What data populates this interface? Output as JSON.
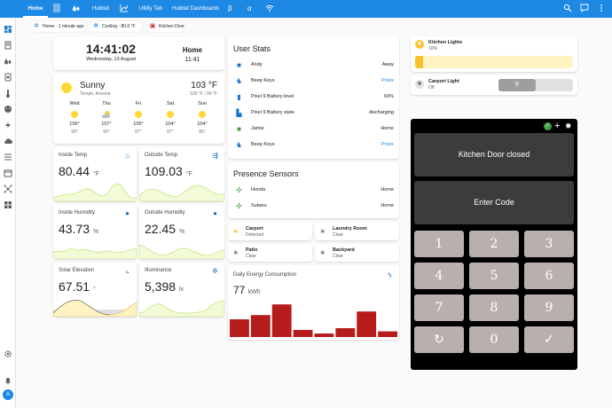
{
  "topbar": {
    "tabs": [
      {
        "label": "Home",
        "active": true
      },
      {
        "label": "Hubitat"
      },
      {
        "label": "Utility Tab"
      },
      {
        "label": "Hubitat Dashboards"
      }
    ],
    "glyph_tabs": [
      "β",
      "α"
    ],
    "colors": {
      "bar": "#1e88e5"
    }
  },
  "chips": [
    {
      "text": "Home · 1 minute ago",
      "icon": "home-sync-icon"
    },
    {
      "text": "Cooling · 80.6 °F",
      "icon": "thermostat-icon"
    },
    {
      "text": "Kitchen Door",
      "icon": "door-icon"
    }
  ],
  "clock": {
    "time": "14:41:02",
    "date": "Wednesday, 13 August",
    "zone_label": "Home",
    "zone_time": "11:41"
  },
  "weather": {
    "condition": "Sunny",
    "location": "Tempe, Arizona",
    "temp": "103 °F",
    "range": "109 °F / 99 °F",
    "forecast": [
      {
        "day": "Wed",
        "icon": "sun",
        "high": "109°",
        "low": "99°"
      },
      {
        "day": "Thu",
        "icon": "partly-cloudy",
        "high": "107°",
        "low": "90°"
      },
      {
        "day": "Fri",
        "icon": "sun",
        "high": "105°",
        "low": "87°"
      },
      {
        "day": "Sat",
        "icon": "sun",
        "high": "104°",
        "low": "87°"
      },
      {
        "day": "Sun",
        "icon": "sun",
        "high": "104°",
        "low": "85°"
      }
    ]
  },
  "sensors": [
    {
      "title": "Inside Temp",
      "value": "80.44",
      "unit": "°F",
      "icon": "thermostat-icon"
    },
    {
      "title": "Outside Temp",
      "value": "109.03",
      "unit": "°F",
      "icon": "thermometer-icon"
    },
    {
      "title": "Inside Humidity",
      "value": "43.73",
      "unit": "%",
      "icon": "water-drop-icon"
    },
    {
      "title": "Outside Humidity",
      "value": "22.45",
      "unit": "%",
      "icon": "water-drop-icon"
    },
    {
      "title": "Solar Elevation",
      "value": "67.51",
      "unit": "°",
      "icon": "sun-angle-icon"
    },
    {
      "title": "Illuminance",
      "value": "5,398",
      "unit": "lx",
      "icon": "brightness-icon"
    }
  ],
  "user_stats": {
    "title": "User Stats",
    "rows": [
      {
        "name": "Andy",
        "value": "Away",
        "icon": "person-icon",
        "accent": false
      },
      {
        "name": "Beep Keys",
        "value": "Press",
        "icon": "bell-icon",
        "accent": true
      },
      {
        "name": "Pixel 9 Battery level",
        "value": "69%",
        "icon": "battery-icon",
        "accent": false
      },
      {
        "name": "Pixel 9 Battery state",
        "value": "discharging",
        "icon": "battery-charging-icon",
        "accent": false
      },
      {
        "name": "Jamie",
        "value": "Home",
        "icon": "person-icon",
        "accent": false
      },
      {
        "name": "Beep Keys",
        "value": "Press",
        "icon": "bell-icon",
        "accent": true
      }
    ]
  },
  "presence": {
    "title": "Presence Sensors",
    "rows": [
      {
        "name": "Honda",
        "value": "Home"
      },
      {
        "name": "Subaru",
        "value": "Home"
      }
    ]
  },
  "motion": [
    {
      "name": "Carport",
      "state": "Detected",
      "active": true
    },
    {
      "name": "Laundry Room",
      "state": "Clear",
      "active": false
    },
    {
      "name": "Patio",
      "state": "Clear",
      "active": false
    },
    {
      "name": "Backyard",
      "state": "Clear",
      "active": false
    }
  ],
  "energy": {
    "title": "Daily Energy Consumption",
    "value": "77",
    "unit": "kWh",
    "bars": [
      0.5,
      0.62,
      0.92,
      0.2,
      0.1,
      0.25,
      0.72,
      0.16
    ]
  },
  "lights": [
    {
      "name": "Kitchen Lights",
      "state": "10%",
      "level": 0.1
    },
    {
      "name": "Carport Light",
      "state": "Off",
      "level": 0
    }
  ],
  "keypad": {
    "status": "Kitchen Door closed",
    "prompt": "Enter Code",
    "keys": [
      "1",
      "2",
      "3",
      "4",
      "5",
      "6",
      "7",
      "8",
      "9",
      "↻",
      "0",
      "✓"
    ]
  },
  "avatar": "A"
}
